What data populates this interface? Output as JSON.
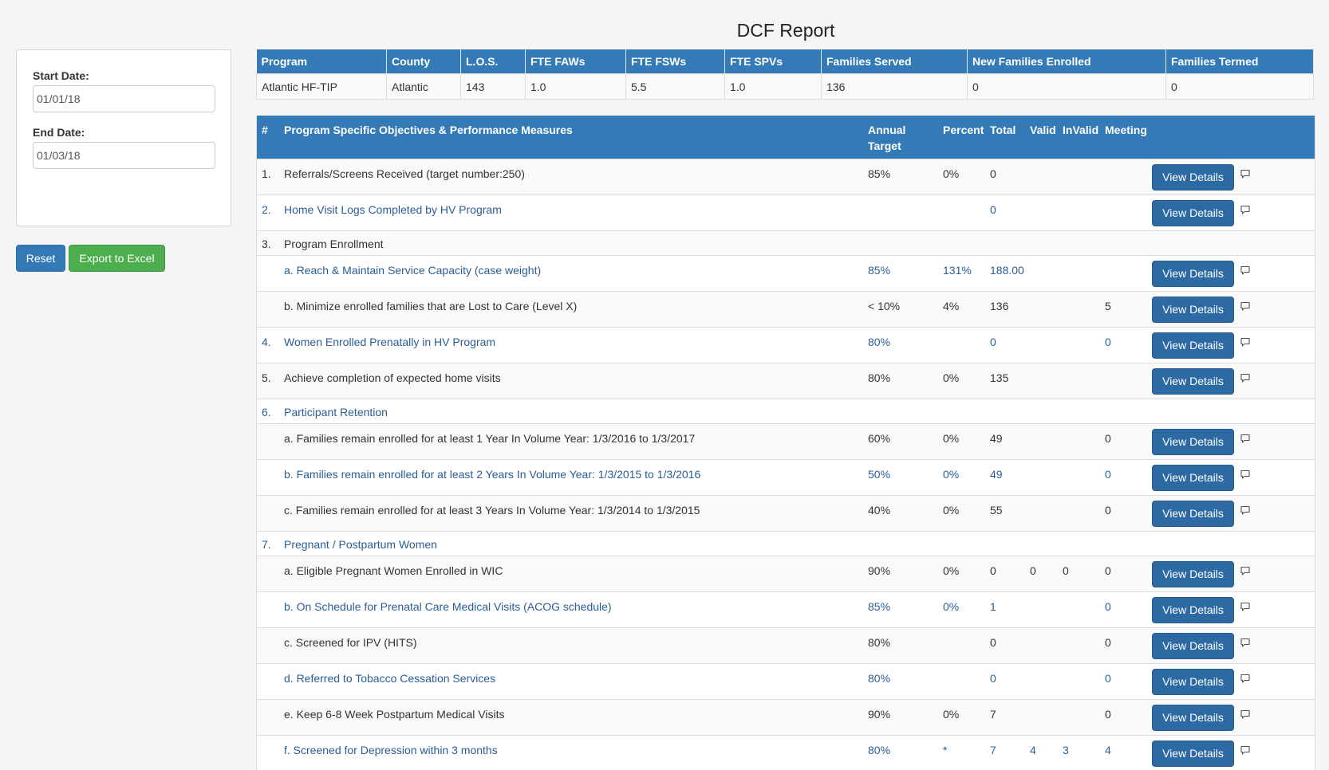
{
  "page_title": "DCF Report",
  "filters": {
    "start_label": "Start Date:",
    "start_value": "01/01/18",
    "end_label": "End Date:",
    "end_value": "01/03/18",
    "reset_label": "Reset",
    "export_label": "Export to Excel"
  },
  "program_table": {
    "headers": [
      "Program",
      "County",
      "L.O.S.",
      "FTE FAWs",
      "FTE FSWs",
      "FTE SPVs",
      "Families Served",
      "New Families Enrolled",
      "Families Termed"
    ],
    "row": [
      "Atlantic HF-TIP",
      "Atlantic",
      "143",
      "1.0",
      "5.5",
      "1.0",
      "136",
      "0",
      "0"
    ]
  },
  "measures": {
    "headers": {
      "num": "#",
      "objective": "Program Specific Objectives & Performance Measures",
      "annual_line1": "Annual",
      "annual_line2": "Target",
      "percent": "Percent",
      "total": "Total",
      "valid": "Valid",
      "invalid": "InValid",
      "meeting": "Meeting"
    },
    "view_label": "View Details",
    "comment_icon": "comment-icon",
    "rows": [
      {
        "num": "1.",
        "label": "Referrals/Screens Received (target number:250)",
        "target": "85%",
        "percent": "0%",
        "total": "0",
        "valid": "",
        "invalid": "",
        "meeting": "",
        "kind": "full",
        "stripe": "odd",
        "link": false
      },
      {
        "num": "2.",
        "label": "Home Visit Logs Completed by HV Program",
        "target": "",
        "percent": "",
        "total": "0",
        "valid": "",
        "invalid": "",
        "meeting": "",
        "kind": "full",
        "stripe": "even",
        "link": true
      },
      {
        "num": "3.",
        "label": "Program Enrollment",
        "target": "",
        "percent": "",
        "total": "",
        "valid": "",
        "invalid": "",
        "meeting": "",
        "kind": "head",
        "stripe": "odd",
        "link": false
      },
      {
        "num": "",
        "label": "a. Reach & Maintain Service Capacity (case weight)",
        "target": "85%",
        "percent": "131%",
        "total": "188.00",
        "valid": "",
        "invalid": "",
        "meeting": "",
        "kind": "full",
        "stripe": "even",
        "link": true
      },
      {
        "num": "",
        "label": "b. Minimize enrolled families that are Lost to Care (Level X)",
        "target": "< 10%",
        "percent": "4%",
        "total": "136",
        "valid": "",
        "invalid": "",
        "meeting": "5",
        "kind": "full",
        "stripe": "odd",
        "link": false
      },
      {
        "num": "4.",
        "label": "Women Enrolled Prenatally in HV Program",
        "target": "80%",
        "percent": "",
        "total": "0",
        "valid": "",
        "invalid": "",
        "meeting": "0",
        "kind": "full",
        "stripe": "even",
        "link": true
      },
      {
        "num": "5.",
        "label": "Achieve completion of expected home visits",
        "target": "80%",
        "percent": "0%",
        "total": "135",
        "valid": "",
        "invalid": "",
        "meeting": "",
        "kind": "full",
        "stripe": "odd",
        "link": false
      },
      {
        "num": "6.",
        "label": "Participant Retention",
        "target": "",
        "percent": "",
        "total": "",
        "valid": "",
        "invalid": "",
        "meeting": "",
        "kind": "head",
        "stripe": "even",
        "link": true
      },
      {
        "num": "",
        "label": "a. Families remain enrolled for at least 1 Year In Volume Year: 1/3/2016 to 1/3/2017",
        "target": "60%",
        "percent": "0%",
        "total": "49",
        "valid": "",
        "invalid": "",
        "meeting": "0",
        "kind": "full",
        "stripe": "odd",
        "link": false
      },
      {
        "num": "",
        "label": "b. Families remain enrolled for at least 2 Years In Volume Year: 1/3/2015 to 1/3/2016",
        "target": "50%",
        "percent": "0%",
        "total": "49",
        "valid": "",
        "invalid": "",
        "meeting": "0",
        "kind": "full",
        "stripe": "even",
        "link": true
      },
      {
        "num": "",
        "label": "c. Families remain enrolled for at least 3 Years In Volume Year: 1/3/2014 to 1/3/2015",
        "target": "40%",
        "percent": "0%",
        "total": "55",
        "valid": "",
        "invalid": "",
        "meeting": "0",
        "kind": "full",
        "stripe": "odd",
        "link": false
      },
      {
        "num": "7.",
        "label": "Pregnant / Postpartum Women",
        "target": "",
        "percent": "",
        "total": "",
        "valid": "",
        "invalid": "",
        "meeting": "",
        "kind": "head",
        "stripe": "even",
        "link": true
      },
      {
        "num": "",
        "label": "a. Eligible Pregnant Women Enrolled in WIC",
        "target": "90%",
        "percent": "0%",
        "total": "0",
        "valid": "0",
        "invalid": "0",
        "meeting": "0",
        "kind": "full",
        "stripe": "odd",
        "link": false
      },
      {
        "num": "",
        "label": "b. On Schedule for Prenatal Care Medical Visits (ACOG schedule)",
        "target": "85%",
        "percent": "0%",
        "total": "1",
        "valid": "",
        "invalid": "",
        "meeting": "0",
        "kind": "full",
        "stripe": "even",
        "link": true
      },
      {
        "num": "",
        "label": "c. Screened for IPV (HITS)",
        "target": "80%",
        "percent": "",
        "total": "0",
        "valid": "",
        "invalid": "",
        "meeting": "0",
        "kind": "full",
        "stripe": "odd",
        "link": false
      },
      {
        "num": "",
        "label": "d. Referred to Tobacco Cessation Services",
        "target": "80%",
        "percent": "",
        "total": "0",
        "valid": "",
        "invalid": "",
        "meeting": "0",
        "kind": "full",
        "stripe": "even",
        "link": true
      },
      {
        "num": "",
        "label": "e. Keep 6-8 Week Postpartum Medical Visits",
        "target": "90%",
        "percent": "0%",
        "total": "7",
        "valid": "",
        "invalid": "",
        "meeting": "0",
        "kind": "full",
        "stripe": "odd",
        "link": false
      },
      {
        "num": "",
        "label": "f. Screened for Depression within 3 months",
        "target": "80%",
        "percent": "*",
        "total": "7",
        "valid": "4",
        "invalid": "3",
        "meeting": "4",
        "kind": "full",
        "stripe": "even",
        "link": true
      }
    ]
  }
}
